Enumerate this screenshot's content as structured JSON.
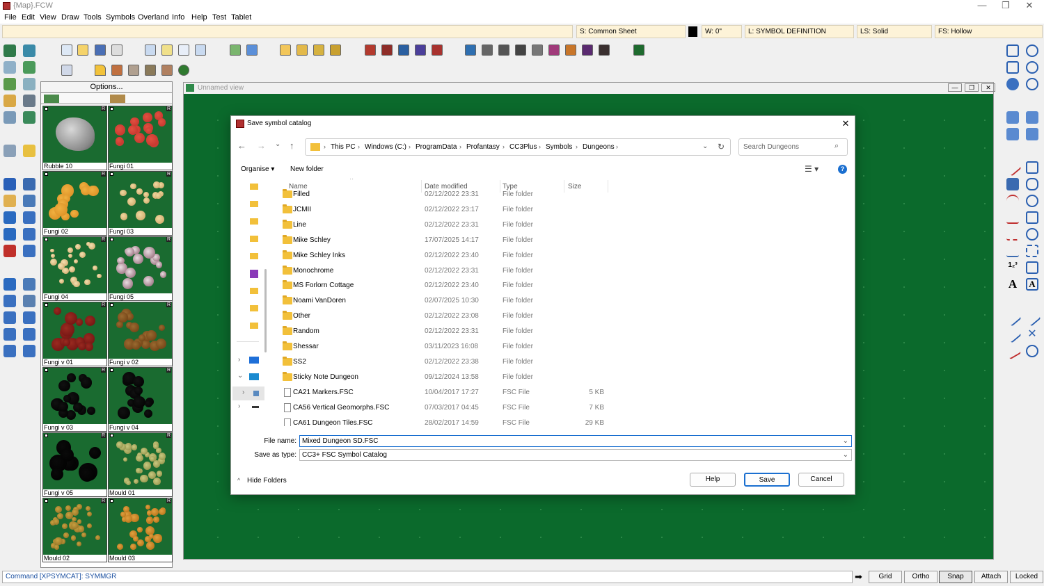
{
  "window": {
    "title": "{Map}.FCW",
    "minimize": "—",
    "maximize": "❐",
    "close": "✕"
  },
  "menu": [
    "File",
    "Edit",
    "View",
    "Draw",
    "Tools",
    "Symbols",
    "Overland",
    "Info",
    "Help",
    "Test",
    "Tablet"
  ],
  "status": {
    "sheet": "S: Common Sheet",
    "width": "W: 0\"",
    "layer": "L: SYMBOL DEFINITION",
    "line_style": "LS: Solid",
    "fill_style": "FS: Hollow"
  },
  "palette": {
    "options_label": "Options...",
    "symbols": [
      {
        "name": "Rubble 10",
        "kind": "rubble"
      },
      {
        "name": "Fungi 01",
        "kind": "red"
      },
      {
        "name": "Fungi 02",
        "kind": "orange"
      },
      {
        "name": "Fungi 03",
        "kind": "cream"
      },
      {
        "name": "Fungi 04",
        "kind": "cream-small"
      },
      {
        "name": "Fungi 05",
        "kind": "rings"
      },
      {
        "name": "Fungi v 01",
        "kind": "darkred"
      },
      {
        "name": "Fungi v 02",
        "kind": "brown"
      },
      {
        "name": "Fungi v 03",
        "kind": "black"
      },
      {
        "name": "Fungi v 04",
        "kind": "black"
      },
      {
        "name": "Fungi v 05",
        "kind": "black-large"
      },
      {
        "name": "Mould 01",
        "kind": "mould-green"
      },
      {
        "name": "Mould 02",
        "kind": "mould-gold"
      },
      {
        "name": "Mould 03",
        "kind": "mould-orange"
      }
    ]
  },
  "map": {
    "title": "Unnamed view"
  },
  "dialog": {
    "title": "Save symbol catalog",
    "breadcrumb": [
      "This PC",
      "Windows (C:)",
      "ProgramData",
      "Profantasy",
      "CC3Plus",
      "Symbols",
      "Dungeons"
    ],
    "search_placeholder": "Search Dungeons",
    "organise": "Organise ▾",
    "new_folder": "New folder",
    "columns": {
      "name": "Name",
      "date": "Date modified",
      "type": "Type",
      "size": "Size"
    },
    "files": [
      {
        "name": "Filled",
        "date": "02/12/2022 23:31",
        "type": "File folder",
        "size": "",
        "is_folder": true
      },
      {
        "name": "JCMII",
        "date": "02/12/2022 23:17",
        "type": "File folder",
        "size": "",
        "is_folder": true
      },
      {
        "name": "Line",
        "date": "02/12/2022 23:31",
        "type": "File folder",
        "size": "",
        "is_folder": true
      },
      {
        "name": "Mike Schley",
        "date": "17/07/2025 14:17",
        "type": "File folder",
        "size": "",
        "is_folder": true
      },
      {
        "name": "Mike Schley Inks",
        "date": "02/12/2022 23:40",
        "type": "File folder",
        "size": "",
        "is_folder": true
      },
      {
        "name": "Monochrome",
        "date": "02/12/2022 23:31",
        "type": "File folder",
        "size": "",
        "is_folder": true
      },
      {
        "name": "MS Forlorn Cottage",
        "date": "02/12/2022 23:40",
        "type": "File folder",
        "size": "",
        "is_folder": true
      },
      {
        "name": "Noami VanDoren",
        "date": "02/07/2025 10:30",
        "type": "File folder",
        "size": "",
        "is_folder": true
      },
      {
        "name": "Other",
        "date": "02/12/2022 23:08",
        "type": "File folder",
        "size": "",
        "is_folder": true
      },
      {
        "name": "Random",
        "date": "02/12/2022 23:31",
        "type": "File folder",
        "size": "",
        "is_folder": true
      },
      {
        "name": "Shessar",
        "date": "03/11/2023 16:08",
        "type": "File folder",
        "size": "",
        "is_folder": true
      },
      {
        "name": "SS2",
        "date": "02/12/2022 23:38",
        "type": "File folder",
        "size": "",
        "is_folder": true
      },
      {
        "name": "Sticky Note Dungeon",
        "date": "09/12/2024 13:58",
        "type": "File folder",
        "size": "",
        "is_folder": true
      },
      {
        "name": "CA21 Markers.FSC",
        "date": "10/04/2017 17:27",
        "type": "FSC File",
        "size": "5 KB",
        "is_folder": false
      },
      {
        "name": "CA56 Vertical Geomorphs.FSC",
        "date": "07/03/2017 04:45",
        "type": "FSC File",
        "size": "7 KB",
        "is_folder": false
      },
      {
        "name": "CA61 Dungeon Tiles.FSC",
        "date": "28/02/2017 14:59",
        "type": "FSC File",
        "size": "29 KB",
        "is_folder": false
      }
    ],
    "file_name_label": "File name:",
    "file_name_value": "Mixed Dungeon SD.FSC",
    "save_type_label": "Save as type:",
    "save_type_value": "CC3+ FSC Symbol Catalog",
    "hide_folders": "Hide Folders",
    "help": "Help",
    "save": "Save",
    "cancel": "Cancel"
  },
  "command": {
    "text": "Command [XPSYMCAT]:  SYMMGR"
  },
  "modes": [
    "Grid",
    "Ortho",
    "Snap",
    "Attach",
    "Locked"
  ]
}
